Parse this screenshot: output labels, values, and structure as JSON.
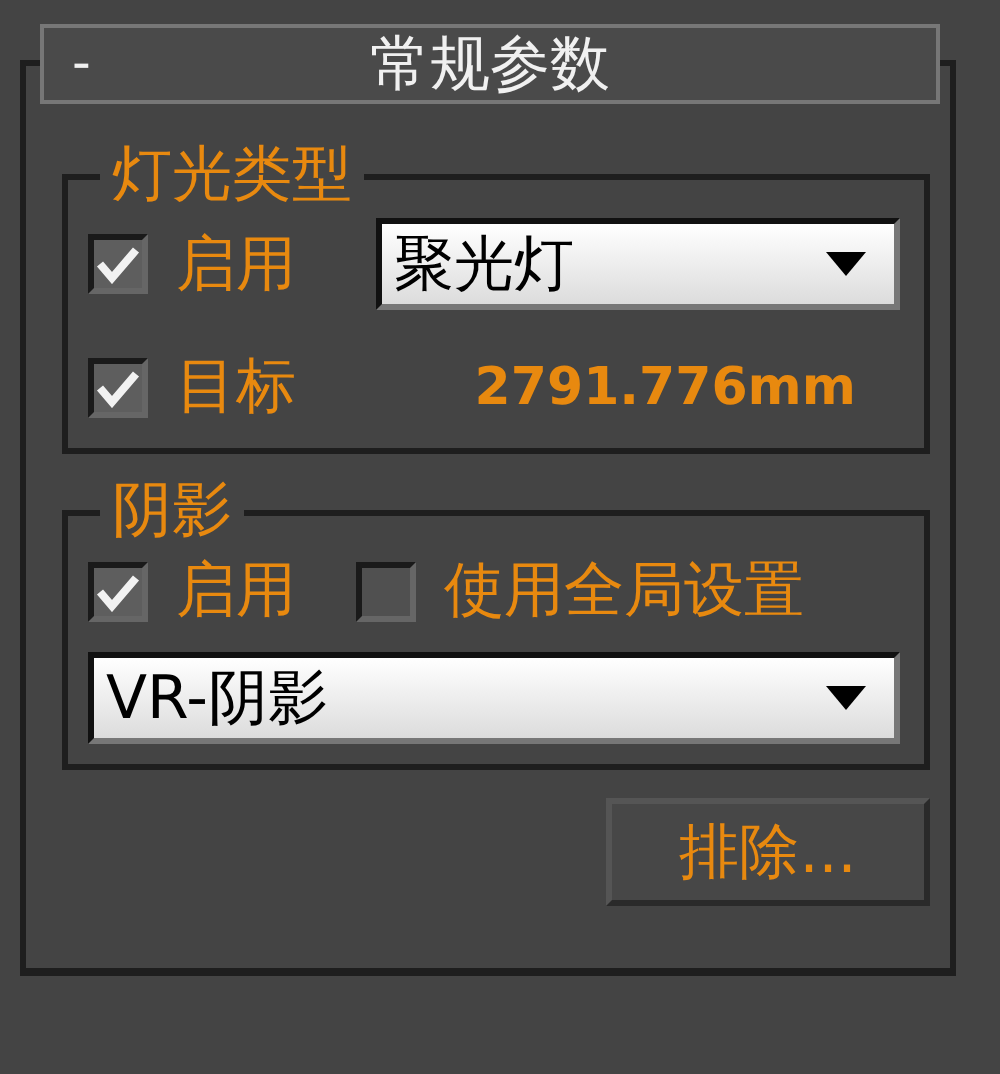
{
  "rollout": {
    "collapse_symbol": "-",
    "title": "常规参数"
  },
  "light_type": {
    "title": "灯光类型",
    "enabled": {
      "label": "启用",
      "checked": true
    },
    "type_dropdown": {
      "value": "聚光灯"
    },
    "target": {
      "label": "目标",
      "checked": true
    },
    "target_distance": "2791.776mm"
  },
  "shadows": {
    "title": "阴影",
    "enabled": {
      "label": "启用",
      "checked": true
    },
    "use_global": {
      "label": "使用全局设置",
      "checked": false
    },
    "type_dropdown": {
      "value": "VR-阴影"
    }
  },
  "exclude_button": {
    "label": "排除..."
  }
}
